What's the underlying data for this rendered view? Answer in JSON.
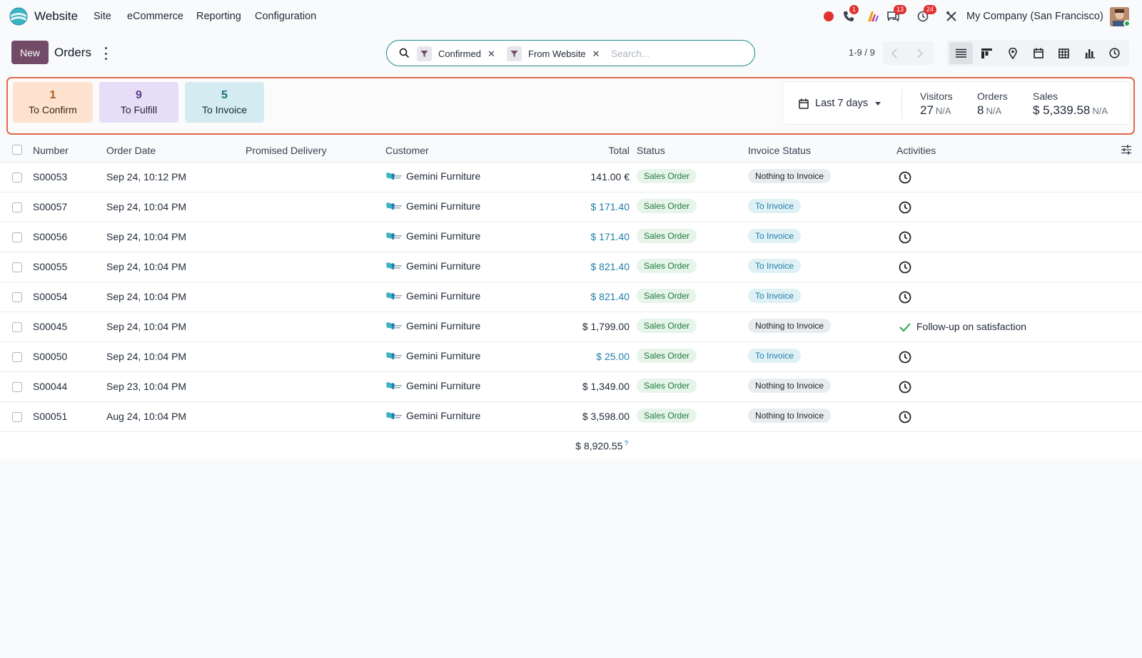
{
  "nav": {
    "app_name": "Website",
    "menus": [
      "Site",
      "eCommerce",
      "Reporting",
      "Configuration"
    ],
    "badges": {
      "calls": "1",
      "messages": "13",
      "activities": "24"
    },
    "company": "My Company (San Francisco)"
  },
  "control": {
    "new_label": "New",
    "breadcrumb": "Orders",
    "facets": [
      "Confirmed",
      "From Website"
    ],
    "search_placeholder": "Search...",
    "pager": "1-9 / 9"
  },
  "dashboard": {
    "cards": [
      {
        "count": "1",
        "label": "To Confirm"
      },
      {
        "count": "9",
        "label": "To Fulfill"
      },
      {
        "count": "5",
        "label": "To Invoice"
      }
    ],
    "period": "Last 7 days",
    "stats": [
      {
        "label": "Visitors",
        "value": "27",
        "suffix": "N/A"
      },
      {
        "label": "Orders",
        "value": "8",
        "suffix": "N/A"
      },
      {
        "label": "Sales",
        "value": "$ 5,339.58",
        "suffix": "N/A"
      }
    ]
  },
  "table": {
    "headers": [
      "Number",
      "Order Date",
      "Promised Delivery",
      "Customer",
      "Total",
      "Status",
      "Invoice Status",
      "Activities"
    ],
    "rows": [
      {
        "number": "S00053",
        "date": "Sep 24, 10:12 PM",
        "customer": "Gemini Furniture",
        "total": "141.00 €",
        "status": "Sales Order",
        "invoice": "Nothing to Invoice",
        "activity": ""
      },
      {
        "number": "S00057",
        "date": "Sep 24, 10:04 PM",
        "customer": "Gemini Furniture",
        "total": "$ 171.40",
        "status": "Sales Order",
        "invoice": "To Invoice",
        "activity": ""
      },
      {
        "number": "S00056",
        "date": "Sep 24, 10:04 PM",
        "customer": "Gemini Furniture",
        "total": "$ 171.40",
        "status": "Sales Order",
        "invoice": "To Invoice",
        "activity": ""
      },
      {
        "number": "S00055",
        "date": "Sep 24, 10:04 PM",
        "customer": "Gemini Furniture",
        "total": "$ 821.40",
        "status": "Sales Order",
        "invoice": "To Invoice",
        "activity": ""
      },
      {
        "number": "S00054",
        "date": "Sep 24, 10:04 PM",
        "customer": "Gemini Furniture",
        "total": "$ 821.40",
        "status": "Sales Order",
        "invoice": "To Invoice",
        "activity": ""
      },
      {
        "number": "S00045",
        "date": "Sep 24, 10:04 PM",
        "customer": "Gemini Furniture",
        "total": "$ 1,799.00",
        "status": "Sales Order",
        "invoice": "Nothing to Invoice",
        "activity": "Follow-up on satisfaction"
      },
      {
        "number": "S00050",
        "date": "Sep 24, 10:04 PM",
        "customer": "Gemini Furniture",
        "total": "$ 25.00",
        "status": "Sales Order",
        "invoice": "To Invoice",
        "activity": ""
      },
      {
        "number": "S00044",
        "date": "Sep 23, 10:04 PM",
        "customer": "Gemini Furniture",
        "total": "$ 1,349.00",
        "status": "Sales Order",
        "invoice": "Nothing to Invoice",
        "activity": ""
      },
      {
        "number": "S00051",
        "date": "Aug 24, 10:04 PM",
        "customer": "Gemini Furniture",
        "total": "$ 3,598.00",
        "status": "Sales Order",
        "invoice": "Nothing to Invoice",
        "activity": ""
      }
    ],
    "sum_total": "$ 8,920.55",
    "sum_hint": "?"
  },
  "colors": {
    "brand": "#714b67",
    "accent": "#1f7ea9",
    "highlight_frame": "#e0694a",
    "badge": "#e03131"
  }
}
